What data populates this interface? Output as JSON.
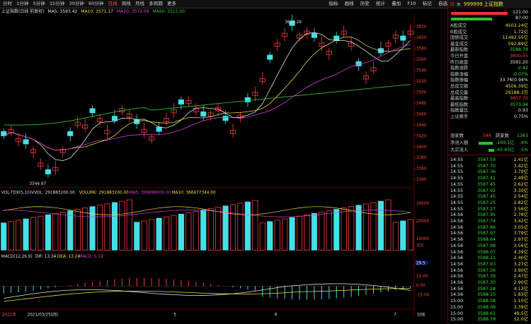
{
  "toolbar": {
    "items": [
      "分时",
      "1分钟",
      "5分钟",
      "15分钟",
      "30分钟",
      "60分钟",
      "日线",
      "周线",
      "月线",
      "多周期",
      "更多"
    ],
    "active_index": 6,
    "right_items": [
      "指标",
      "画线",
      "历史",
      "统计",
      "疊加",
      "F10",
      "标记",
      "自选"
    ]
  },
  "price_legend": {
    "name": "上证指数(日线 前复权)",
    "ma5": "MA5: 3593.42",
    "ma10": "MA10: 3571.17",
    "ma20": "MA20: 3572.09",
    "ma60": "MA60: 3515.00"
  },
  "volume_legend": {
    "label": "VOL-TDX(5,10)",
    "vvol": "VVOL: 291883200.00",
    "volume": "VOLUME: 291883200.00",
    "ma5": "MA5: 306696000.00",
    "ma10": "MA10: 366477344.00"
  },
  "macd_legend": {
    "label": "MACD(12,26,9)",
    "dif": "DIF: 13.34",
    "dea": "DEA: 13.24",
    "macd": "MACD: 0.19"
  },
  "annotations": {
    "high": "3629.29",
    "low": "3344.97"
  },
  "price_axis": [
    "3620",
    "3600",
    "3580",
    "3560",
    "3540",
    "3520",
    "3500",
    "3480",
    "3460",
    "3440",
    "3420",
    "3400",
    "3380",
    "3360",
    "3340"
  ],
  "volume_axis": [
    "30000",
    "20000",
    "10000"
  ],
  "volume_unit": "X万",
  "macd_axis": [
    "29.5",
    "15.00",
    "0.00",
    "-15.00"
  ],
  "date_axis": [
    "2021年",
    "2021/03/25(四)",
    "5",
    "6",
    "7"
  ],
  "bottom_right_label": "日线",
  "right_panel": {
    "code": "999999",
    "name": "上证指数",
    "red_count": "121.00",
    "green_count": "87.00",
    "stats": [
      {
        "k": "A股成交",
        "v": "4503.24亿",
        "c": "yel"
      },
      {
        "k": "B股成交",
        "v": "1.72亿",
        "c": "yel"
      },
      {
        "k": "国债成交",
        "v": "11492.55亿",
        "c": "yel"
      },
      {
        "k": "基金成交",
        "v": "592.89亿",
        "c": "yel"
      },
      {
        "k": "最新指数",
        "v": "3588.78",
        "c": "grn"
      },
      {
        "k": "今日开盘",
        "v": "3600.55",
        "c": "red"
      },
      {
        "k": "昨日收盘",
        "v": "3591.20",
        "c": "wht"
      },
      {
        "k": "指数涨跌",
        "v": "-2.42",
        "c": "grn"
      },
      {
        "k": "指数涨幅",
        "v": "-0.07%",
        "c": "grn"
      },
      {
        "k": "指数振幅",
        "v": "33.76(0.94%",
        "c": "wht"
      },
      {
        "k": "总成交额",
        "v": "4506.39亿",
        "c": "yel"
      },
      {
        "k": "总成交量",
        "v": "29188.3万",
        "c": "yel"
      },
      {
        "k": "最高指数",
        "v": "3607.70",
        "c": "red"
      },
      {
        "k": "最低指数",
        "v": "3573.94",
        "c": "grn"
      },
      {
        "k": "指数量比",
        "v": "0.93",
        "c": "wht"
      },
      {
        "k": "上证换手",
        "v": "0.75%",
        "c": "wht"
      }
    ],
    "updown": {
      "up_label": "涨家数",
      "up": "546",
      "down_label": "跌家数",
      "down": "1363"
    },
    "net_in": {
      "k": "净流入额",
      "v": "-169.1亿",
      "p": "-4%"
    },
    "big_in": {
      "k": "大宗流入",
      "v": "-45.65亿",
      "p": "-1%"
    },
    "ticks": [
      {
        "t": "14:55",
        "p": "3587.59",
        "v": "2.41亿"
      },
      {
        "t": "14:55",
        "p": "3587.70",
        "v": "3.42亿"
      },
      {
        "t": "14:55",
        "p": "3587.36",
        "v": "3.79亿"
      },
      {
        "t": "14:55",
        "p": "3587.41",
        "v": "2.49亿"
      },
      {
        "t": "14:55",
        "p": "3587.45",
        "v": "2.62亿"
      },
      {
        "t": "14:55",
        "p": "3587.92",
        "v": "3.30亿"
      },
      {
        "t": "14:55",
        "p": "3587.45",
        "v": "2.54亿"
      },
      {
        "t": "14:55",
        "p": "3587.25",
        "v": "2.82亿"
      },
      {
        "t": "14:55",
        "p": "3587.27",
        "v": "3.56亿"
      },
      {
        "t": "14:56",
        "p": "3587.95",
        "v": "2.78亿"
      },
      {
        "t": "14:56",
        "p": "3587.74",
        "v": "3.42亿"
      },
      {
        "t": "14:56",
        "p": "3587.86",
        "v": "3.05亿"
      },
      {
        "t": "14:56",
        "p": "3587.97",
        "v": "3.79亿"
      },
      {
        "t": "14:56",
        "p": "3588.64",
        "v": "2.97亿"
      },
      {
        "t": "14:56",
        "p": "3587.98",
        "v": "3.56亿"
      },
      {
        "t": "14:56",
        "p": "3588.07",
        "v": "4.39亿"
      },
      {
        "t": "14:56",
        "p": "3588.21",
        "v": "2.40亿"
      },
      {
        "t": "14:56",
        "p": "3587.93",
        "v": "3.27亿"
      },
      {
        "t": "14:56",
        "p": "3587.56",
        "v": "3.90亿"
      },
      {
        "t": "14:56",
        "p": "3587.39",
        "v": "2.47亿"
      },
      {
        "t": "14:56",
        "p": "3587.30",
        "v": "2.90亿"
      },
      {
        "t": "14:56",
        "p": "3587.28",
        "v": "4.13亿"
      },
      {
        "t": "14:56",
        "p": "3588.10",
        "v": "1.83亿"
      },
      {
        "t": "15:00",
        "p": "3588.08",
        "v": "1.10亿"
      },
      {
        "t": "15:00",
        "p": "3588.08",
        "v": "3.39亿"
      },
      {
        "t": "15:00",
        "p": "3588.61",
        "v": "49.5亿"
      },
      {
        "t": "15:00",
        "p": "3588.78",
        "v": "12.0亿"
      }
    ]
  },
  "colors": {
    "up": "#ff4040",
    "down": "#44e0e8",
    "ma5": "#e8e8e8",
    "ma10": "#f0e040",
    "ma20": "#e040e0",
    "ma60": "#30c030",
    "grid": "#7a0000"
  }
}
